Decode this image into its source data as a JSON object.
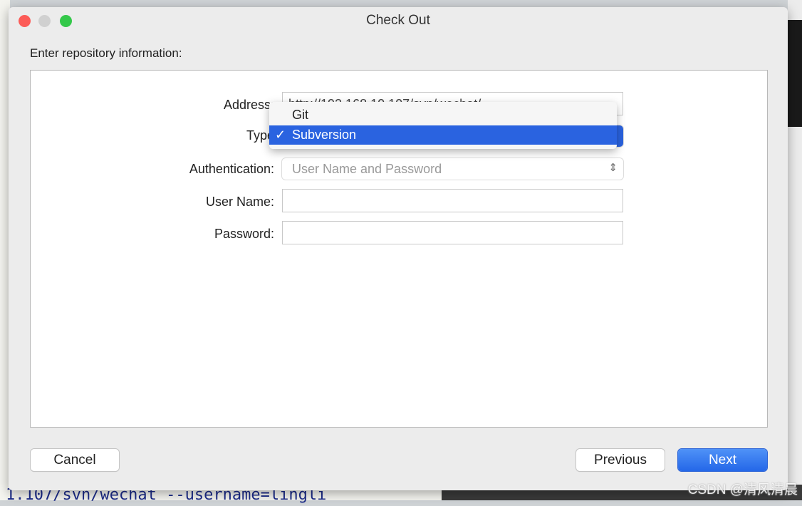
{
  "window": {
    "title": "Check Out",
    "instruction": "Enter repository information:"
  },
  "form": {
    "address_label": "Address:",
    "address_value": "http://192.168.10.107/svn/wechat/",
    "type_label": "Type",
    "type_options": [
      "Git",
      "Subversion"
    ],
    "type_selected": "Subversion",
    "auth_label": "Authentication:",
    "auth_value": "User Name and Password",
    "username_label": "User Name:",
    "username_value": "",
    "password_label": "Password:",
    "password_value": ""
  },
  "buttons": {
    "cancel": "Cancel",
    "previous": "Previous",
    "next": "Next"
  },
  "background": {
    "terminal_text": "1.107/svn/wechat --username=lingli"
  },
  "watermark": "CSDN @清风清晨",
  "colors": {
    "accent": "#2a63e0"
  }
}
